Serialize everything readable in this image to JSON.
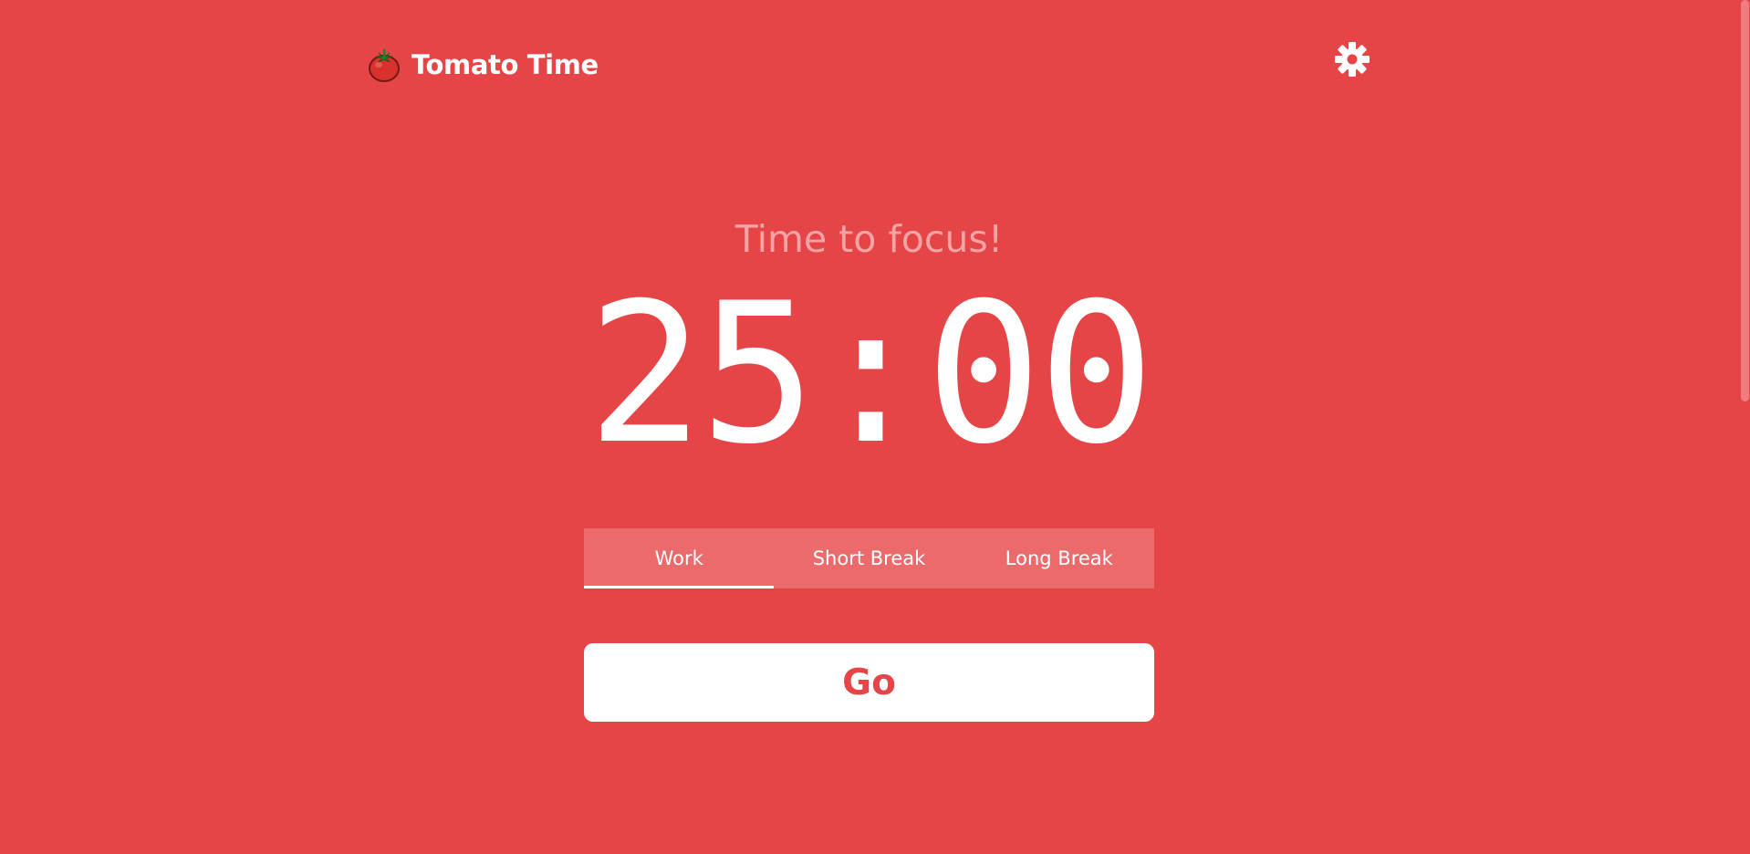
{
  "header": {
    "logo_icon": "tomato-icon",
    "app_name": "Tomato Time",
    "settings_icon": "gear-icon"
  },
  "timer": {
    "status": "Time to focus!",
    "time": "25:00"
  },
  "modes": [
    {
      "label": "Work",
      "active": true
    },
    {
      "label": "Short Break",
      "active": false
    },
    {
      "label": "Long Break",
      "active": false
    }
  ],
  "actions": {
    "go_label": "Go"
  },
  "colors": {
    "background": "#e64548",
    "tab_bar": "#eb6b6d",
    "status_text": "#f5a3a4",
    "button_text": "#e64548",
    "white": "#ffffff"
  }
}
